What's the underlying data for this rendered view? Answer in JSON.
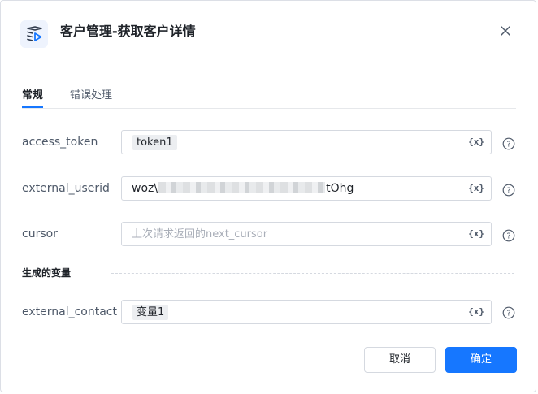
{
  "dialog": {
    "title": "客户管理-获取客户详情",
    "cancel_label": "取消",
    "ok_label": "确定"
  },
  "tabs": [
    {
      "label": "常规",
      "active": true
    },
    {
      "label": "错误处理",
      "active": false
    }
  ],
  "fields": {
    "access_token": {
      "label": "access_token",
      "chip": "token1"
    },
    "external_userid": {
      "label": "external_userid",
      "value_prefix": "woz\\",
      "value_suffix": "tOhg",
      "redacted": true
    },
    "cursor": {
      "label": "cursor",
      "placeholder": "上次请求返回的next_cursor"
    },
    "external_contact": {
      "label": "external_contact",
      "chip": "变量1"
    }
  },
  "section": {
    "generated_vars_title": "生成的变量"
  },
  "icons": {
    "variable_icon_text": "{x}",
    "help_icon_glyph": "?"
  },
  "colors": {
    "primary": "#1677ff",
    "border": "#d5d9e0",
    "text": "#1f2329",
    "muted": "#4e5969",
    "placeholder": "#a9aeb8"
  }
}
